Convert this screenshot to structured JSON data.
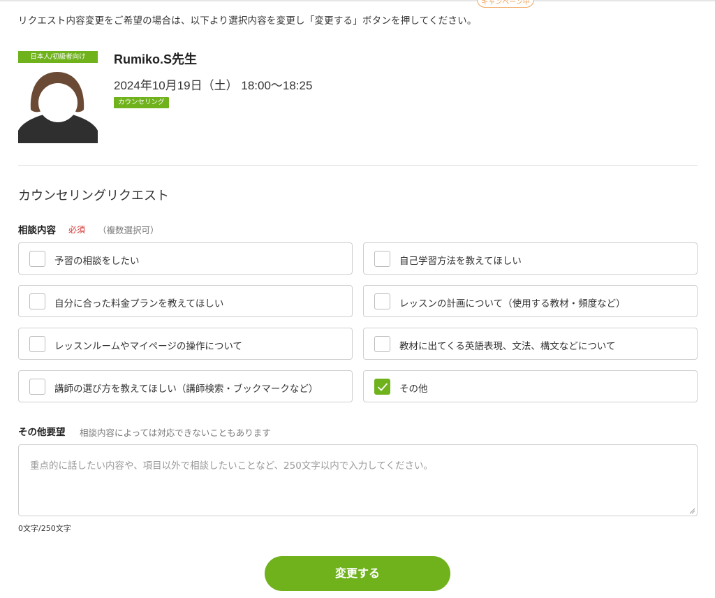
{
  "campaign_tab": "キャンペーン中",
  "intro_text": "リクエスト内容変更をご希望の場合は、以下より選択内容を変更し「変更する」ボタンを押してください。",
  "teacher": {
    "badge": "日本人/初級者向け",
    "name": "Rumiko.S先生",
    "date": "2024年10月19日（土） 18:00〜18:25",
    "lesson_type": "カウンセリング"
  },
  "form": {
    "section_title": "カウンセリングリクエスト",
    "topic_label": "相談内容",
    "required_text": "必須",
    "multi_note": "（複数選択可）",
    "options": [
      {
        "label": "予習の相談をしたい",
        "checked": false
      },
      {
        "label": "自己学習方法を教えてほしい",
        "checked": false
      },
      {
        "label": "自分に合った料金プランを教えてほしい",
        "checked": false
      },
      {
        "label": "レッスンの計画について（使用する教材・頻度など）",
        "checked": false
      },
      {
        "label": "レッスンルームやマイページの操作について",
        "checked": false
      },
      {
        "label": "教材に出てくる英語表現、文法、構文などについて",
        "checked": false
      },
      {
        "label": "講師の選び方を教えてほしい（講師検索・ブックマークなど）",
        "checked": false
      },
      {
        "label": "その他",
        "checked": true
      }
    ],
    "other_label": "その他要望",
    "other_note": "相談内容によっては対応できないこともあります",
    "textarea_placeholder": "重点的に話したい内容や、項目以外で相談したいことなど、250文字以内で入力してください。",
    "counter": "0文字/250文字",
    "submit_label": "変更する"
  },
  "colors": {
    "accent": "#6fb21c",
    "required": "#d0312d",
    "campaign": "#f0a35a"
  }
}
